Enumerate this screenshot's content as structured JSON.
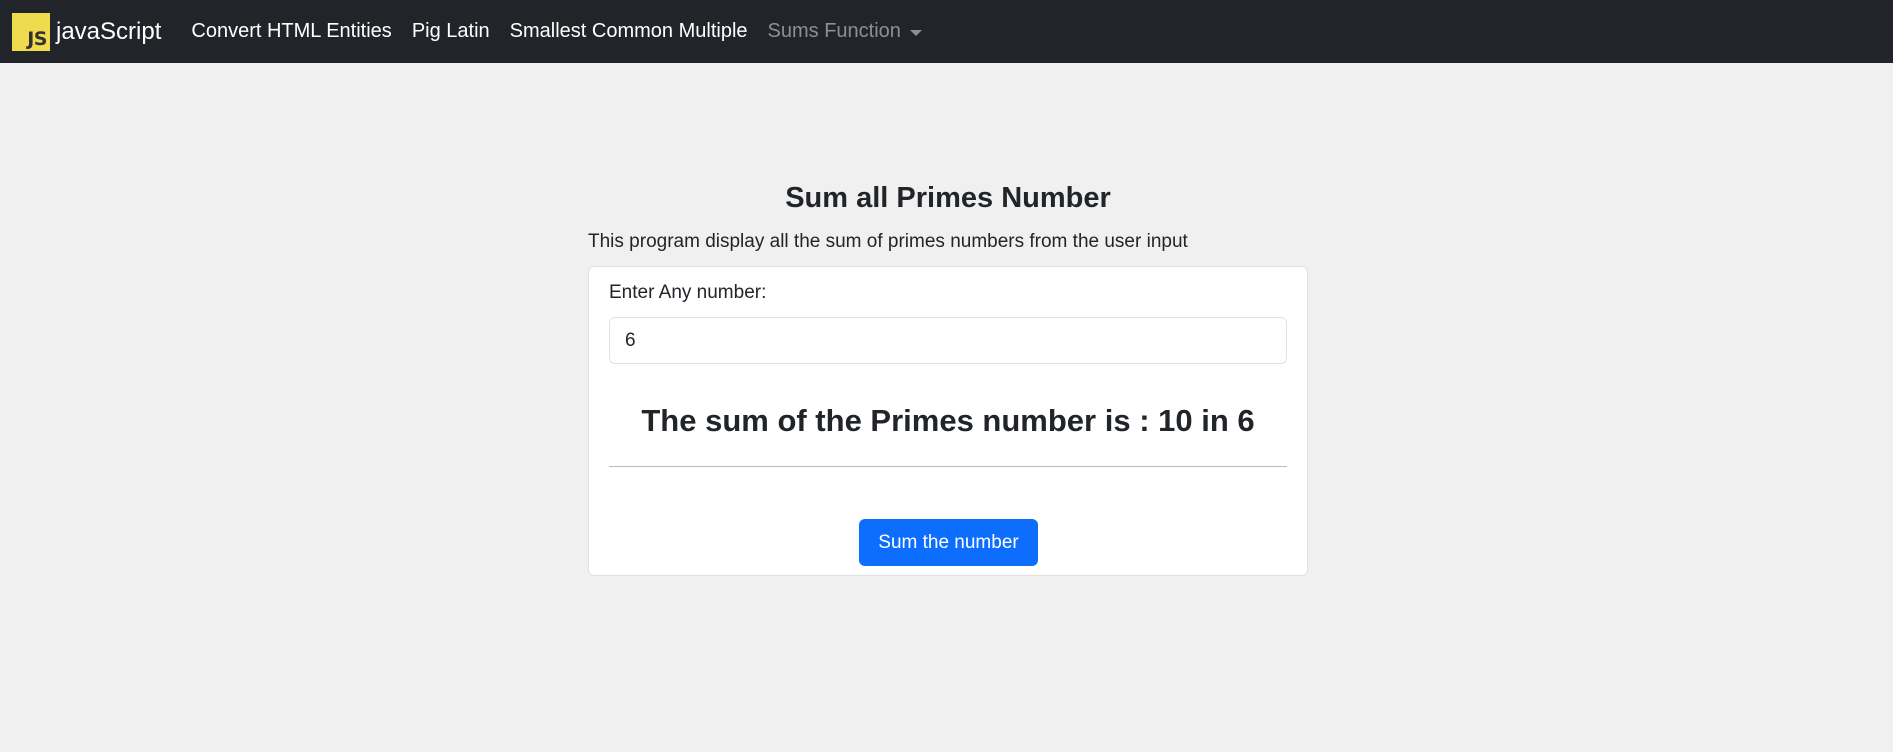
{
  "navbar": {
    "brand_logo_text": "JS",
    "brand_text": "javaScript",
    "links": [
      {
        "label": "Convert HTML Entities"
      },
      {
        "label": "Pig Latin"
      },
      {
        "label": "Smallest Common Multiple"
      }
    ],
    "dropdown_label": "Sums Function"
  },
  "main": {
    "title": "Sum all Primes Number",
    "description": "This program display all the sum of primes numbers from the user input",
    "form": {
      "label": "Enter Any number:",
      "input_value": "6",
      "result": "The sum of the Primes number is : 10 in 6",
      "button_label": "Sum the number"
    }
  },
  "colors": {
    "navbar_bg": "#212529",
    "page_bg": "#f0f0f0",
    "js_logo": "#f0db4f",
    "primary_button": "#0d6efd"
  }
}
